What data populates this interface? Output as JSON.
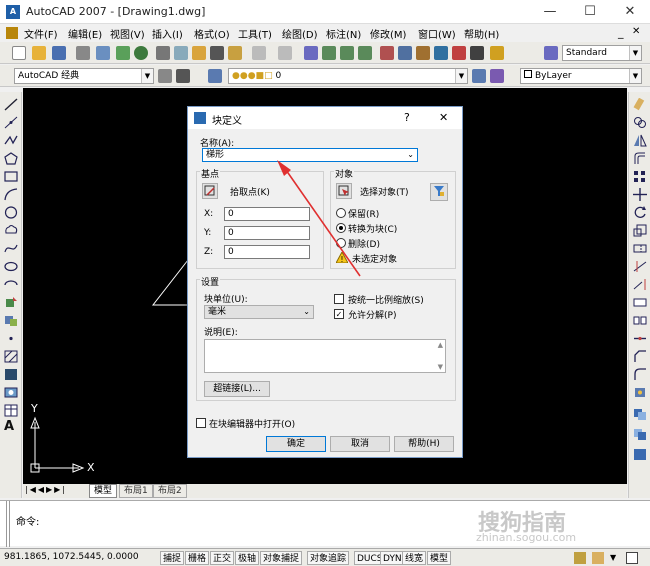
{
  "window": {
    "title": "AutoCAD 2007 - [Drawing1.dwg]",
    "minimize_glyph": "—",
    "maximize_glyph": "☐",
    "close_glyph": "✕"
  },
  "menu": [
    "文件(F)",
    "编辑(E)",
    "视图(V)",
    "插入(I)",
    "格式(O)",
    "工具(T)",
    "绘图(D)",
    "标注(N)",
    "修改(M)",
    "窗口(W)",
    "帮助(H)"
  ],
  "toolbar": {
    "text_style": "Standard",
    "workspace": "AutoCAD 经典",
    "layer": "0",
    "color": "ByLayer"
  },
  "canvas": {
    "axis_y_label": "Y",
    "axis_x_label": "X"
  },
  "layout_tabs": [
    "模型",
    "布局1",
    "布局2"
  ],
  "command": {
    "prompt": "命令:"
  },
  "status": {
    "coordinates": "981.1865,  1072.5445, 0.0000",
    "buttons": [
      "捕捉",
      "栅格",
      "正交",
      "极轴",
      "对象捕捉",
      "对象追踪",
      "DUCS",
      "DYN",
      "线宽",
      "模型"
    ]
  },
  "watermark": {
    "text": "搜狗指南",
    "subtext": "zhinan.sogou.com"
  },
  "dialog": {
    "title": "块定义",
    "help_glyph": "?",
    "close_glyph": "✕",
    "name_label": "名称(A):",
    "name_value": "梯形",
    "basepoint": {
      "group_label": "基点",
      "pick_label": "拾取点(K)",
      "x_label": "X:",
      "y_label": "Y:",
      "z_label": "Z:",
      "x_value": "0",
      "y_value": "0",
      "z_value": "0"
    },
    "objects": {
      "group_label": "对象",
      "select_label": "选择对象(T)",
      "retain_label": "保留(R)",
      "convert_label": "转换为块(C)",
      "delete_label": "删除(D)",
      "warning_text": "未选定对象"
    },
    "settings": {
      "group_label": "设置",
      "unit_label": "块单位(U):",
      "unit_value": "毫米",
      "scale_uniform_label": "按统一比例缩放(S)",
      "allow_explode_label": "允许分解(P)",
      "description_label": "说明(E):",
      "hyperlink_label": "超链接(L)..."
    },
    "open_in_editor_label": "在块编辑器中打开(O)",
    "ok_label": "确定",
    "cancel_label": "取消",
    "help_label": "帮助(H)"
  },
  "colors": {
    "canvas": "#000000",
    "annotation_arrow": "#e03030",
    "dialog_accent": "#0078d7"
  }
}
